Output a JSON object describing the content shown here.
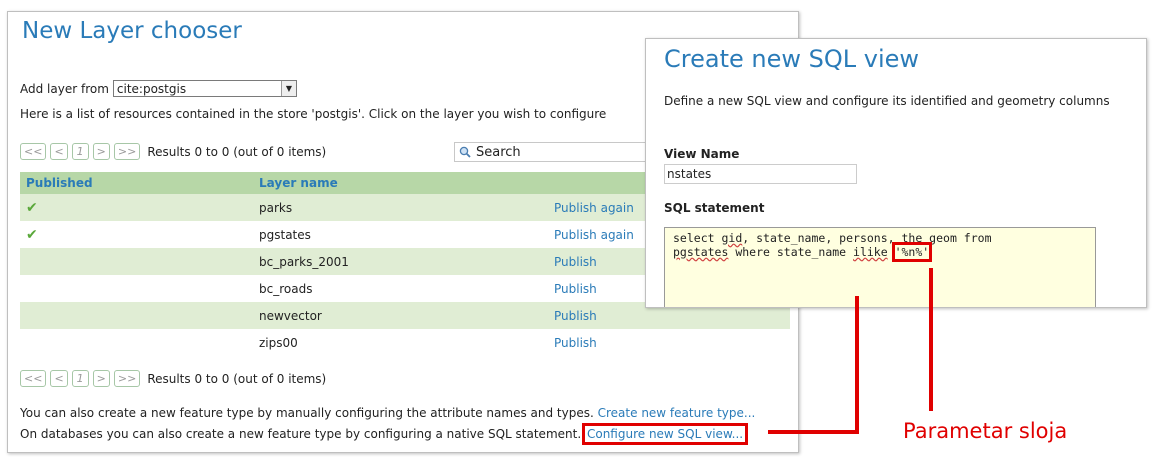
{
  "chooser": {
    "title": "New Layer chooser",
    "add_label": "Add layer from",
    "store_value": "cite:postgis",
    "description": "Here is a list of resources contained in the store 'postgis'. Click on the layer you wish to configure",
    "pager": {
      "first": "<<",
      "prev": "<",
      "page": "1",
      "next": ">",
      "last": ">>",
      "results": "Results 0 to 0 (out of 0 items)"
    },
    "search_label": "Search",
    "columns": {
      "published": "Published",
      "layer_name": "Layer name"
    },
    "rows": [
      {
        "published": true,
        "name": "parks",
        "action": "Publish again"
      },
      {
        "published": true,
        "name": "pgstates",
        "action": "Publish again"
      },
      {
        "published": false,
        "name": "bc_parks_2001",
        "action": "Publish"
      },
      {
        "published": false,
        "name": "bc_roads",
        "action": "Publish"
      },
      {
        "published": false,
        "name": "newvector",
        "action": "Publish"
      },
      {
        "published": false,
        "name": "zips00",
        "action": "Publish"
      }
    ],
    "footer_text1": "You can also create a new feature type by manually configuring the attribute names and types.",
    "footer_link1": "Create new feature type...",
    "footer_text2": "On databases you can also create a new feature type by configuring a native SQL statement.",
    "footer_link2": "Configure new SQL view..."
  },
  "sqlview": {
    "title": "Create new SQL view",
    "subtitle": "Define a new SQL view and configure its identified and geometry columns",
    "view_name_label": "View Name",
    "view_name_value": "nstates",
    "sql_label": "SQL statement",
    "sql": {
      "l1_a": "select ",
      "l1_gid": "gid",
      "l1_b": ", state_name, persons, the_geom from",
      "l2_pg": "pgstates",
      "l2_a": " where state_name ",
      "l2_ilike": "ilike",
      "l2_b": " ",
      "param": "'%n%'"
    }
  },
  "annotation": {
    "label": "Parametar sloja",
    "color": "#e00000"
  }
}
